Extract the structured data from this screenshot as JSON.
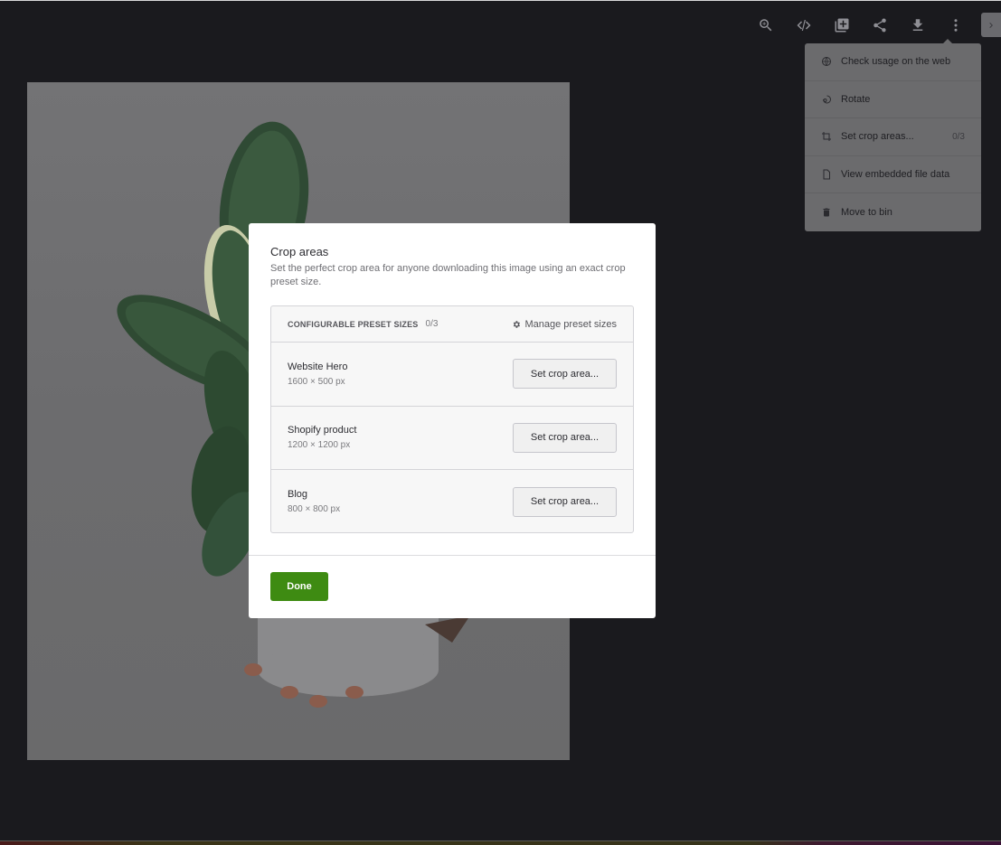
{
  "toolbar": {
    "buttons": [
      {
        "name": "zoom-in",
        "icon": "zoom-in-icon"
      },
      {
        "name": "embed",
        "icon": "code-icon"
      },
      {
        "name": "add-to-collection",
        "icon": "add-to-collection-icon"
      },
      {
        "name": "share",
        "icon": "share-icon"
      },
      {
        "name": "download",
        "icon": "download-icon"
      },
      {
        "name": "more",
        "icon": "more-vertical-icon"
      }
    ],
    "panel_toggle_icon": "chevron-right-icon"
  },
  "menu": {
    "items": [
      {
        "label": "Check usage on the web",
        "icon": "globe-icon",
        "count": ""
      },
      {
        "label": "Rotate",
        "icon": "rotate-icon",
        "count": ""
      },
      {
        "label": "Set crop areas...",
        "icon": "crop-icon",
        "count": "0/3"
      },
      {
        "label": "View embedded file data",
        "icon": "file-icon",
        "count": ""
      },
      {
        "label": "Move to bin",
        "icon": "trash-icon",
        "count": ""
      }
    ]
  },
  "modal": {
    "title": "Crop areas",
    "description": "Set the perfect crop area for anyone downloading this image using an exact crop preset size.",
    "presets_header": "CONFIGURABLE PRESET SIZES",
    "presets_count": "0/3",
    "manage_label": "Manage preset sizes",
    "presets": [
      {
        "name": "Website Hero",
        "size": "1600 × 500 px",
        "button": "Set crop area..."
      },
      {
        "name": "Shopify product",
        "size": "1200 × 1200 px",
        "button": "Set crop area..."
      },
      {
        "name": "Blog",
        "size": "800 × 800 px",
        "button": "Set crop area..."
      }
    ],
    "done_label": "Done",
    "done_color": "#3e8b12"
  },
  "photo": {
    "subject": "Rubber plant in white pot held by hand"
  }
}
